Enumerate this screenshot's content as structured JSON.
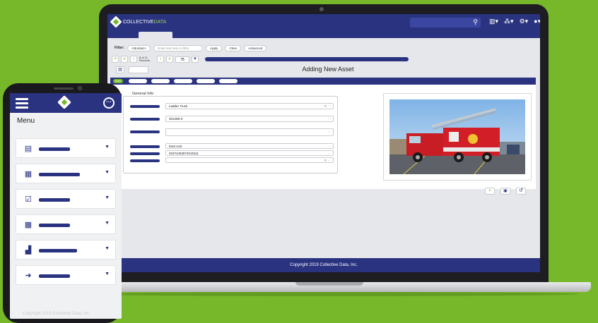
{
  "desktop": {
    "brand": {
      "prefix": "COLLECTIVE",
      "suffix": "DATA"
    },
    "search_icon": "search-icon",
    "filter": {
      "label": "Filter:",
      "select_value": "<Idontain>",
      "input_placeholder": "Enter text here to filter",
      "apply": "Apply",
      "clear": "Clear",
      "advanced": "Advanced"
    },
    "nav": {
      "first": "«",
      "prev_fast": "«",
      "prev": "‹",
      "next": "›",
      "next_fast": "»",
      "last": "»",
      "record_label": "8 of 11 Records",
      "record_input": "75",
      "add": "+"
    },
    "page_title": "Adding New Asset",
    "section_main_tab": "Main",
    "general_info_title": "General Info",
    "fields": [
      {
        "value": "Ladder Truck"
      },
      {
        "value": "301298-S"
      },
      {
        "value": ""
      },
      {
        "value": "East Unit"
      },
      {
        "value": "02374453874019111"
      },
      {
        "value": ""
      }
    ],
    "footer": "Copyright 2019 Collective Data, Inc."
  },
  "mobile": {
    "menu_title": "Menu",
    "items": [
      {
        "icon": "list-icon"
      },
      {
        "icon": "building-icon"
      },
      {
        "icon": "clipboard-check-icon"
      },
      {
        "icon": "calendar-icon"
      },
      {
        "icon": "boxes-icon"
      },
      {
        "icon": "sign-out-icon"
      }
    ],
    "footer": "Copyright 2019 Collective Data, Inc."
  },
  "colors": {
    "background": "#76b82a",
    "primary": "#2a3380",
    "accent": "#76b82a"
  }
}
